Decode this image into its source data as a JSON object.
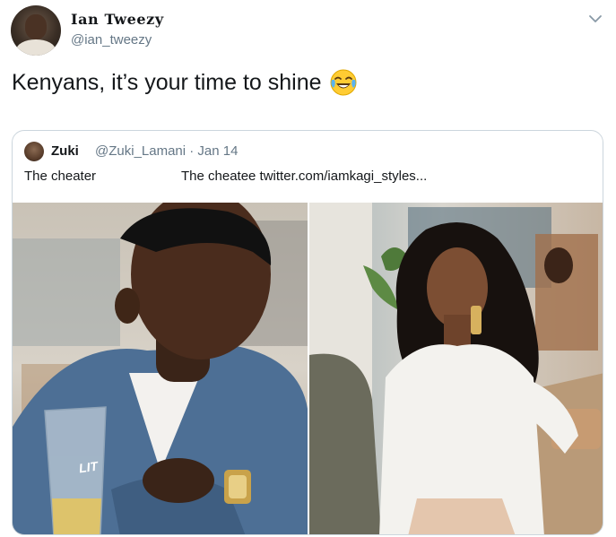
{
  "tweet": {
    "display_name": "Ian Tweezy",
    "handle": "@ian_tweezy",
    "text": "Kenyans, it’s your time to shine",
    "emoji_icon": "face-with-tears-of-joy-icon"
  },
  "quote": {
    "display_name": "Zuki",
    "handle_and_date": "@Zuki_Lamani · Jan 14",
    "text_left": "The cheater",
    "text_right": "The cheatee twitter.com/iamkagi_styles...",
    "glass_text": "LIT"
  },
  "colors": {
    "text_primary": "#14171a",
    "text_secondary": "#657786",
    "border": "#ccd6dd"
  }
}
